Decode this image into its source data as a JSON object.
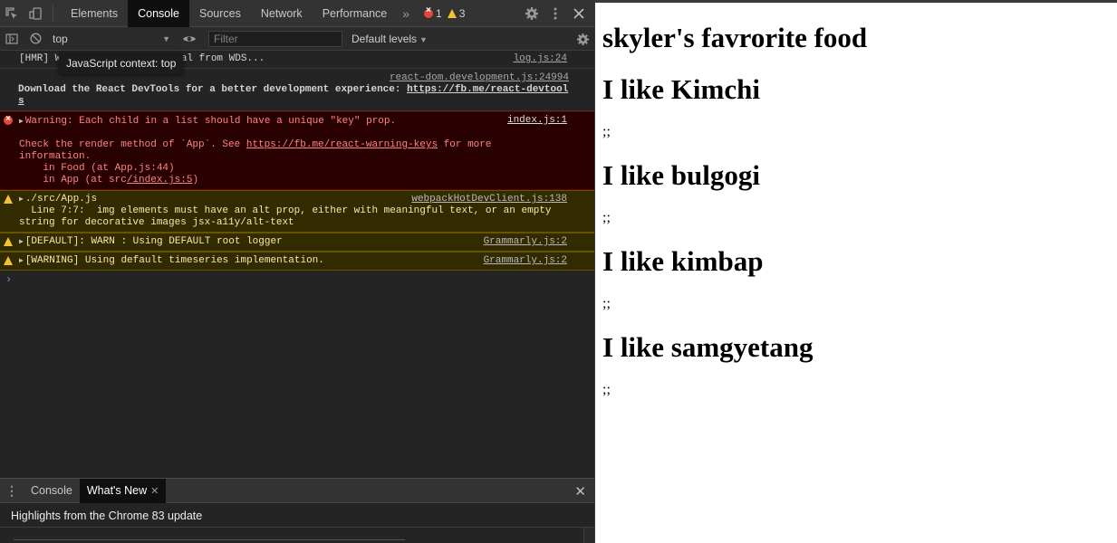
{
  "devtools": {
    "tabs": [
      "Elements",
      "Console",
      "Sources",
      "Network",
      "Performance"
    ],
    "active_tab": "Console",
    "more_tabs_icon": "chevron-double-right-icon",
    "error_count": "1",
    "warning_count": "3",
    "toolbar": {
      "context": "top",
      "filter_placeholder": "Filter",
      "levels": "Default levels"
    },
    "tooltip": "JavaScript context: top",
    "messages": {
      "hmr": {
        "text_start": "[HMR] W",
        "text_end": "nal from WDS...",
        "source": "log.js:24"
      },
      "react_devtools": {
        "source": "react-dom.development.js:24994",
        "text": "Download the React DevTools for a better development experience: ",
        "link_part1": "https://fb.me/react-devtool",
        "link_part2": "s"
      },
      "key_warning": {
        "line1": "Warning: Each child in a list should have a unique \"key\" prop.",
        "source": "index.js:1",
        "line2_prefix": "Check the render method of `App`. See ",
        "line2_link": "https://fb.me/react-warning-keys",
        "line2_suffix": " for more information.",
        "line3": "    in Food (at App.js:44)",
        "line4_prefix": "    in App (at src",
        "line4_link": "/index.js:5",
        "line4_suffix": ")"
      },
      "app_warning": {
        "line1": "./src/App.js",
        "source": "webpackHotDevClient.js:138",
        "line2": "  Line 7:7:  img elements must have an alt prop, either with meaningful text, or an empty",
        "line3": "string for decorative images  jsx-a11y/alt-text"
      },
      "default_warn": {
        "text": "[DEFAULT]: WARN : Using DEFAULT root logger",
        "source": "Grammarly.js:2"
      },
      "timeseries_warn": {
        "text": "[WARNING] Using default timeseries implementation.",
        "source": "Grammarly.js:2"
      }
    },
    "prompt": "›",
    "drawer": {
      "tabs": [
        "Console",
        "What's New"
      ],
      "active_tab": "What's New",
      "highlights": "Highlights from the Chrome 83 update"
    },
    "colors": {
      "panel_bg": "#242424",
      "error_bg": "#290000",
      "warning_bg": "#332b00",
      "error_icon": "#e4463a",
      "warning_icon": "#f3c331"
    }
  },
  "page": {
    "title": "skyler's favrorite food",
    "foods": [
      {
        "heading": "I like Kimchi",
        "note": ";;"
      },
      {
        "heading": "I like bulgogi",
        "note": ";;"
      },
      {
        "heading": "I like kimbap",
        "note": ";;"
      },
      {
        "heading": "I like samgyetang",
        "note": ";;"
      }
    ]
  }
}
